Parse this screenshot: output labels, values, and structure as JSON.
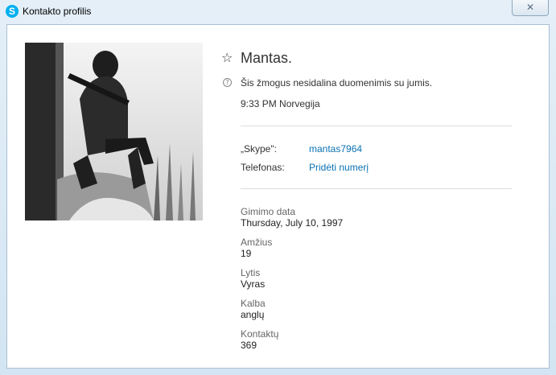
{
  "window": {
    "title": "Kontakto profilis",
    "app_icon_letter": "S",
    "close_glyph": "✕"
  },
  "profile": {
    "name": "Mantas.",
    "privacy_notice": "Šis žmogus nesidalina duomenimis su jumis.",
    "local_time": "9:33 PM Norvegija"
  },
  "contact": {
    "skype_label": "„Skype\":",
    "skype_value": "mantas7964",
    "phone_label": "Telefonas:",
    "phone_value": "Pridėti numerį"
  },
  "details": [
    {
      "label": "Gimimo data",
      "value": "Thursday, July 10, 1997"
    },
    {
      "label": "Amžius",
      "value": "19"
    },
    {
      "label": "Lytis",
      "value": "Vyras"
    },
    {
      "label": "Kalba",
      "value": "anglų"
    },
    {
      "label": "Kontaktų",
      "value": "369"
    }
  ],
  "icons": {
    "star": "☆",
    "info": "?"
  },
  "colors": {
    "link": "#0a72b4",
    "skype_brand": "#00aff0"
  }
}
